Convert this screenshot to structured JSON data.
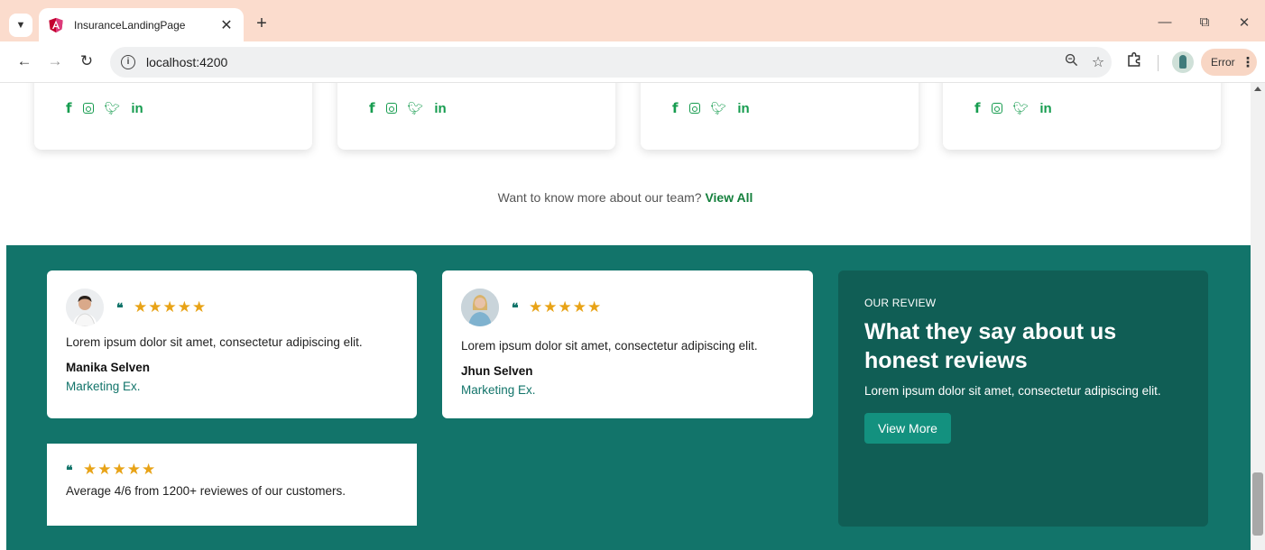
{
  "browser": {
    "tab_title": "InsuranceLandingPage",
    "tab_close": "✕",
    "new_tab": "+",
    "url": "localhost:4200",
    "profile_status": "Error",
    "window": {
      "minimize": "—",
      "restore": "⧉",
      "close": "✕"
    },
    "icons": [
      "tab-search-icon",
      "angular-favicon",
      "back-arrow-icon",
      "forward-arrow-icon",
      "reload-icon",
      "info-icon",
      "zoom-icon",
      "bookmark-star-icon",
      "extensions-icon",
      "profile-avatar",
      "kebab-menu-icon"
    ]
  },
  "team": {
    "card_count": 4,
    "social_icons": [
      "facebook-icon",
      "instagram-icon",
      "twitter-icon",
      "linkedin-icon"
    ],
    "more_text": "Want to know more about our team?",
    "more_link": "View All"
  },
  "reviews": {
    "background": "#12746a",
    "star_color": "#e8a317",
    "items": [
      {
        "stars": "★★★★★",
        "text": "Lorem ipsum dolor sit amet, consectetur adipiscing elit.",
        "name": "Manika Selven",
        "role": "Marketing Ex."
      },
      {
        "stars": "★★★★★",
        "text": "Lorem ipsum dolor sit amet, consectetur adipiscing elit.",
        "name": "Jhun Selven",
        "role": "Marketing Ex."
      }
    ],
    "summary": {
      "stars": "★★★★★",
      "text": "Average 4/6 from 1200+ reviewes of our customers."
    },
    "promo": {
      "kicker": "OUR REVIEW",
      "title": "What they say about us honest reviews",
      "text": "Lorem ipsum dolor sit amet, consectetur adipiscing elit.",
      "button": "View More"
    }
  }
}
